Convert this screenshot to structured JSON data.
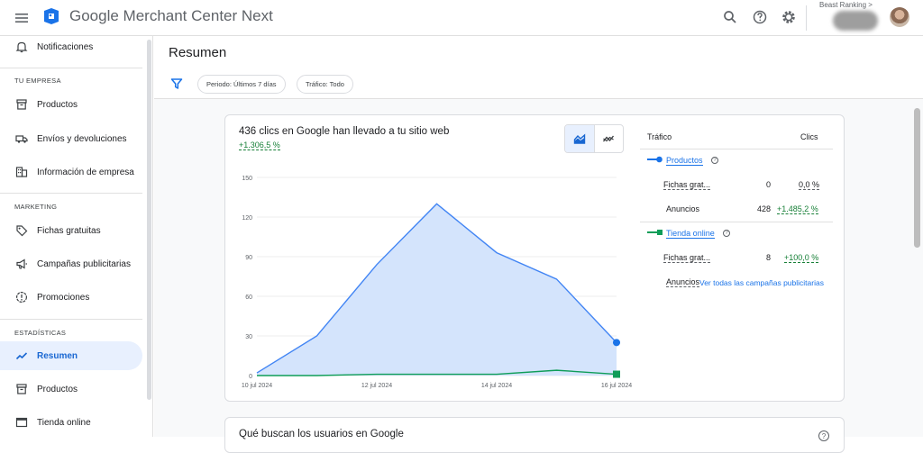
{
  "header": {
    "app_title": "Google Merchant Center Next",
    "account_label": "Beast Ranking >"
  },
  "sidebar": {
    "top_item": "Notificaciones",
    "sections": [
      {
        "title": "TU EMPRESA",
        "items": [
          "Productos",
          "Envíos y devoluciones",
          "Información de empresa"
        ]
      },
      {
        "title": "MARKETING",
        "items": [
          "Fichas gratuitas",
          "Campañas publicitarias",
          "Promociones"
        ]
      },
      {
        "title": "ESTADÍSTICAS",
        "items": [
          "Resumen",
          "Productos",
          "Tienda online"
        ]
      }
    ],
    "active_item": "Resumen"
  },
  "page": {
    "title": "Resumen",
    "filters": [
      "Periodo: Últimos 7 días",
      "Tráfico: Todo"
    ]
  },
  "card": {
    "title": "436 clics en Google han llevado a tu sitio web",
    "delta": "+1.306,5 %",
    "table": {
      "col_traffic": "Tráfico",
      "col_clicks": "Clics",
      "group1": {
        "name": "Productos",
        "rows": [
          {
            "label": "Fichas grat...",
            "value": "0",
            "pct": "0,0 %"
          },
          {
            "label": "Anuncios",
            "value": "428",
            "pct": "+1.485,2 %"
          }
        ]
      },
      "group2": {
        "name": "Tienda online",
        "rows": [
          {
            "label": "Fichas grat...",
            "value": "8",
            "pct": "+100,0 %"
          },
          {
            "label": "Anuncios"
          }
        ]
      },
      "see_all": "Ver todas las campañas publicitarias"
    }
  },
  "card2": {
    "title": "Qué buscan los usuarios en Google"
  },
  "chart_data": {
    "type": "area",
    "x": [
      "10 jul 2024",
      "11 jul 2024",
      "12 jul 2024",
      "13 jul 2024",
      "14 jul 2024",
      "15 jul 2024",
      "16 jul 2024"
    ],
    "xtick_labels": [
      "10 jul 2024",
      "12 jul 2024",
      "14 jul 2024",
      "16 jul 2024"
    ],
    "ylim": [
      0,
      150
    ],
    "yticks": [
      0,
      30,
      60,
      90,
      120,
      150
    ],
    "series": [
      {
        "name": "Productos",
        "color": "#4285f4",
        "values": [
          2,
          30,
          84,
          130,
          93,
          73,
          25
        ]
      },
      {
        "name": "Tienda online",
        "color": "#0f9d58",
        "values": [
          0,
          0,
          1,
          1,
          1,
          4,
          1
        ]
      }
    ],
    "grid": true
  },
  "colors": {
    "accent": "#1a73e8",
    "positive": "#188038",
    "active_bg": "#e8f0fe"
  }
}
